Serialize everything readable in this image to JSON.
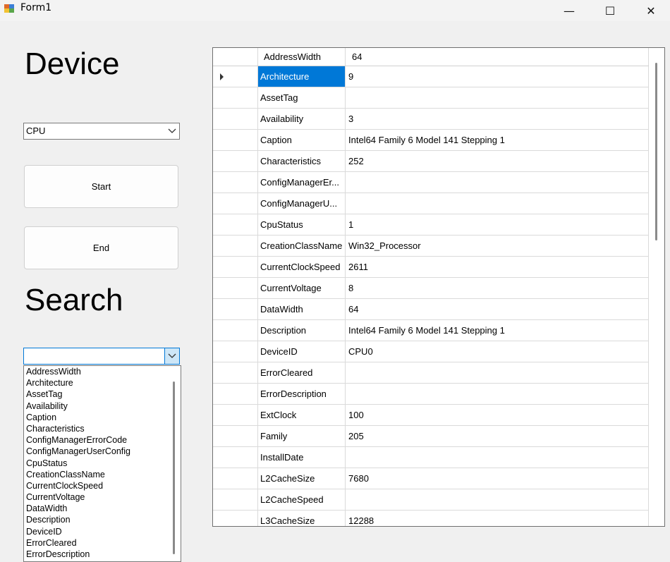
{
  "window": {
    "title": "Form1",
    "minimize": "—",
    "maximize": "☐",
    "close": "✕"
  },
  "left_panel": {
    "device_heading": "Device",
    "device_combo": {
      "value": "CPU",
      "arrow": "⌵"
    },
    "start_button": "Start",
    "end_button": "End",
    "search_heading": "Search",
    "search_combo": {
      "value": "",
      "arrow": "⌵"
    },
    "search_options": [
      "AddressWidth",
      "Architecture",
      "AssetTag",
      "Availability",
      "Caption",
      "Characteristics",
      "ConfigManagerErrorCode",
      "ConfigManagerUserConfig",
      "CpuStatus",
      "CreationClassName",
      "CurrentClockSpeed",
      "CurrentVoltage",
      "DataWidth",
      "Description",
      "DeviceID",
      "ErrorCleared",
      "ErrorDescription"
    ]
  },
  "grid": {
    "header": {
      "name": "AddressWidth",
      "value": "64"
    },
    "rows": [
      {
        "name": "Architecture",
        "value": "9"
      },
      {
        "name": "AssetTag",
        "value": ""
      },
      {
        "name": "Availability",
        "value": "3"
      },
      {
        "name": "Caption",
        "value": "Intel64 Family 6 Model 141 Stepping 1"
      },
      {
        "name": "Characteristics",
        "value": "252"
      },
      {
        "name": "ConfigManagerEr...",
        "value": ""
      },
      {
        "name": "ConfigManagerU...",
        "value": ""
      },
      {
        "name": "CpuStatus",
        "value": "1"
      },
      {
        "name": "CreationClassName",
        "value": "Win32_Processor"
      },
      {
        "name": "CurrentClockSpeed",
        "value": "2611"
      },
      {
        "name": "CurrentVoltage",
        "value": "8"
      },
      {
        "name": "DataWidth",
        "value": "64"
      },
      {
        "name": "Description",
        "value": "Intel64 Family 6 Model 141 Stepping 1"
      },
      {
        "name": "DeviceID",
        "value": "CPU0"
      },
      {
        "name": "ErrorCleared",
        "value": ""
      },
      {
        "name": "ErrorDescription",
        "value": ""
      },
      {
        "name": "ExtClock",
        "value": "100"
      },
      {
        "name": "Family",
        "value": "205"
      },
      {
        "name": "InstallDate",
        "value": ""
      },
      {
        "name": "L2CacheSize",
        "value": "7680"
      },
      {
        "name": "L2CacheSpeed",
        "value": ""
      },
      {
        "name": "L3CacheSize",
        "value": "12288"
      }
    ],
    "selected_row": "Architecture"
  },
  "colors": {
    "selection": "#0078d7",
    "window_bg": "#f0f0f0"
  }
}
